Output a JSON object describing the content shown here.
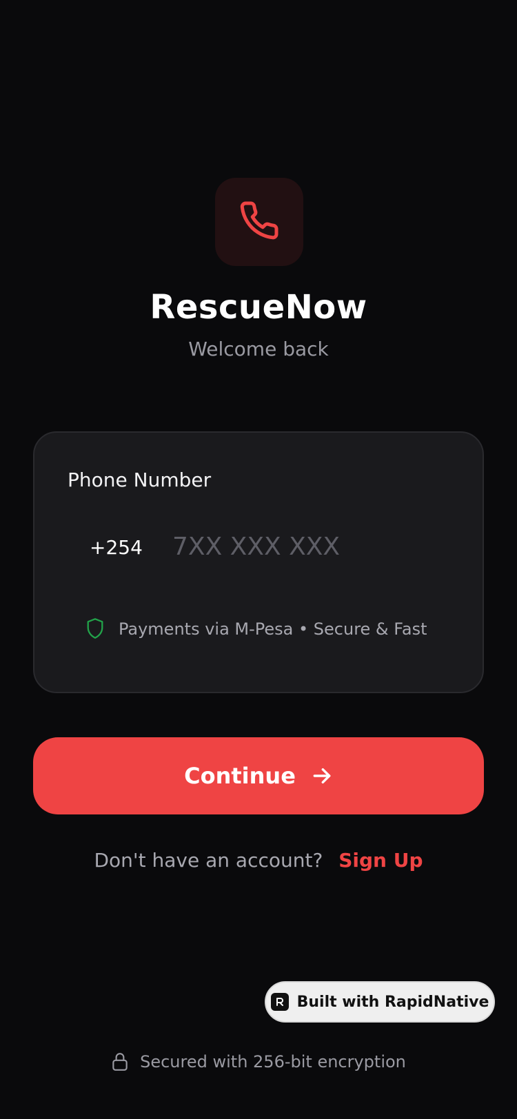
{
  "header": {
    "app_name": "RescueNow",
    "subtitle": "Welcome back",
    "logo_icon": "phone-icon"
  },
  "form": {
    "phone_label": "Phone Number",
    "country_code": "+254",
    "phone_value": "",
    "phone_placeholder": "7XX XXX XXX",
    "secure_note": "Payments via M-Pesa • Secure & Fast",
    "secure_icon": "shield-icon"
  },
  "actions": {
    "continue_label": "Continue",
    "continue_icon": "arrow-right-icon",
    "signup_prompt": "Don't have an account?",
    "signup_link": "Sign Up"
  },
  "badge": {
    "label": "Built with RapidNative"
  },
  "footer": {
    "text": "Secured with 256-bit encryption",
    "icon": "lock-icon"
  },
  "colors": {
    "background": "#0a0a0c",
    "accent": "#ef4444",
    "card": "#1a1a1d",
    "success": "#22a34a"
  }
}
